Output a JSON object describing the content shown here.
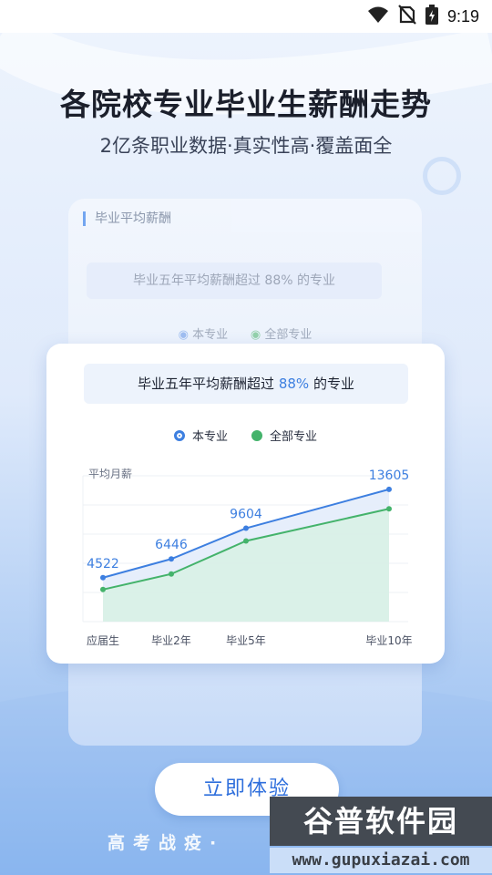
{
  "status_bar": {
    "time": "9:19",
    "icons": [
      "wifi-icon",
      "no-sim-icon",
      "battery-charging-icon"
    ]
  },
  "header": {
    "title": "各院校专业毕业生薪酬走势",
    "subtitle": "2亿条职业数据·真实性高·覆盖面全"
  },
  "back_card": {
    "title": "毕业平均薪酬",
    "banner": "毕业五年平均薪酬超过 88% 的专业",
    "legend": [
      "本专业",
      "全部专业"
    ]
  },
  "front_card": {
    "banner_prefix": "毕业五年平均薪酬超过",
    "banner_highlight": "88%",
    "banner_suffix": "的专业",
    "legend": {
      "major": "本专业",
      "all": "全部专业"
    }
  },
  "colors": {
    "major": "#3d7fe0",
    "all": "#44b36b",
    "accent": "#2f6fdc"
  },
  "chart_data": {
    "type": "line",
    "ylabel": "平均月薪",
    "categories": [
      "应届生",
      "毕业2年",
      "毕业5年",
      "毕业10年"
    ],
    "series": [
      {
        "name": "本专业",
        "values": [
          4522,
          6446,
          9604,
          13605
        ],
        "labels": [
          "4522",
          "6446",
          "9604",
          "13605"
        ]
      },
      {
        "name": "全部专业",
        "values": [
          3300,
          4900,
          8300,
          11600
        ]
      }
    ],
    "ylim": [
      0,
      15000
    ],
    "grid": true
  },
  "cta": {
    "label": "立即体验"
  },
  "footer": {
    "slogan": "高考战疫·"
  },
  "watermark": {
    "title": "谷普软件园",
    "url": "www.gupuxiazai.com"
  }
}
